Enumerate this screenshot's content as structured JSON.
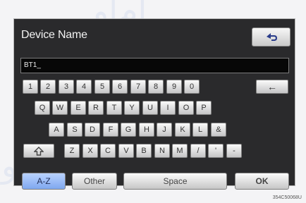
{
  "screen": {
    "title": "Device Name",
    "back_icon": "back-arrow-icon",
    "input_value": "BT1_"
  },
  "keyboard": {
    "row1": [
      "1",
      "2",
      "3",
      "4",
      "5",
      "6",
      "7",
      "8",
      "9",
      "0"
    ],
    "row1_backspace": "←",
    "row2": [
      "Q",
      "W",
      "E",
      "R",
      "T",
      "Y",
      "U",
      "I",
      "O",
      "P"
    ],
    "row3": [
      "A",
      "S",
      "D",
      "F",
      "G",
      "H",
      "J",
      "K",
      "L",
      "&"
    ],
    "row4_shift_icon": "shift-icon",
    "row4": [
      "Z",
      "X",
      "C",
      "V",
      "B",
      "N",
      "M",
      "/",
      "'",
      "-"
    ],
    "mode_az": "A-Z",
    "mode_other": "Other",
    "space": "Space",
    "ok": "OK"
  },
  "image_code": "354C50068U",
  "watermark": {
    "top": "ام‌او",
    "bottom": "و"
  },
  "colors": {
    "background": "#2a2a2c",
    "key_light": "#f7f7f7",
    "key_dark": "#c4c4c6",
    "active_blue": "#9fc0ff"
  }
}
